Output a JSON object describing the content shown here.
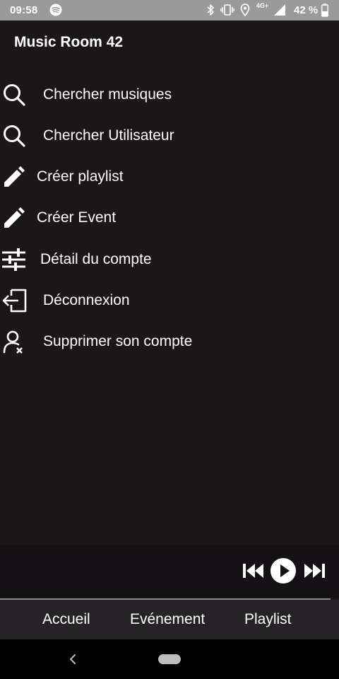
{
  "status_bar": {
    "time": "09:58",
    "network": "4G+",
    "battery": "42 %",
    "icons": [
      "spotify-icon",
      "bluetooth-icon",
      "vibrate-icon",
      "location-icon",
      "signal-icon",
      "battery-icon"
    ]
  },
  "header": {
    "title": "Music Room 42"
  },
  "menu": {
    "items": [
      {
        "label": "Chercher musiques",
        "icon": "search-icon"
      },
      {
        "label": "Chercher Utilisateur",
        "icon": "search-icon"
      },
      {
        "label": "Créer playlist",
        "icon": "pencil-icon"
      },
      {
        "label": "Créer Event",
        "icon": "pencil-icon"
      },
      {
        "label": "Détail du compte",
        "icon": "sliders-icon"
      },
      {
        "label": "Déconnexion",
        "icon": "logout-icon"
      },
      {
        "label": "Supprimer son compte",
        "icon": "delete-user-icon"
      }
    ]
  },
  "player": {
    "controls": [
      "skip-previous-icon",
      "play-icon",
      "skip-next-icon"
    ]
  },
  "tabs": [
    {
      "label": "Accueil"
    },
    {
      "label": "Evénement"
    },
    {
      "label": "Playlist"
    }
  ],
  "system_nav": {
    "icons": [
      "back-icon",
      "home-pill"
    ]
  },
  "colors": {
    "background": "#1b1718",
    "status_bar": "#9a9a9a",
    "player_bar": "#141214",
    "tab_bar": "#262326",
    "text": "#ffffff"
  }
}
